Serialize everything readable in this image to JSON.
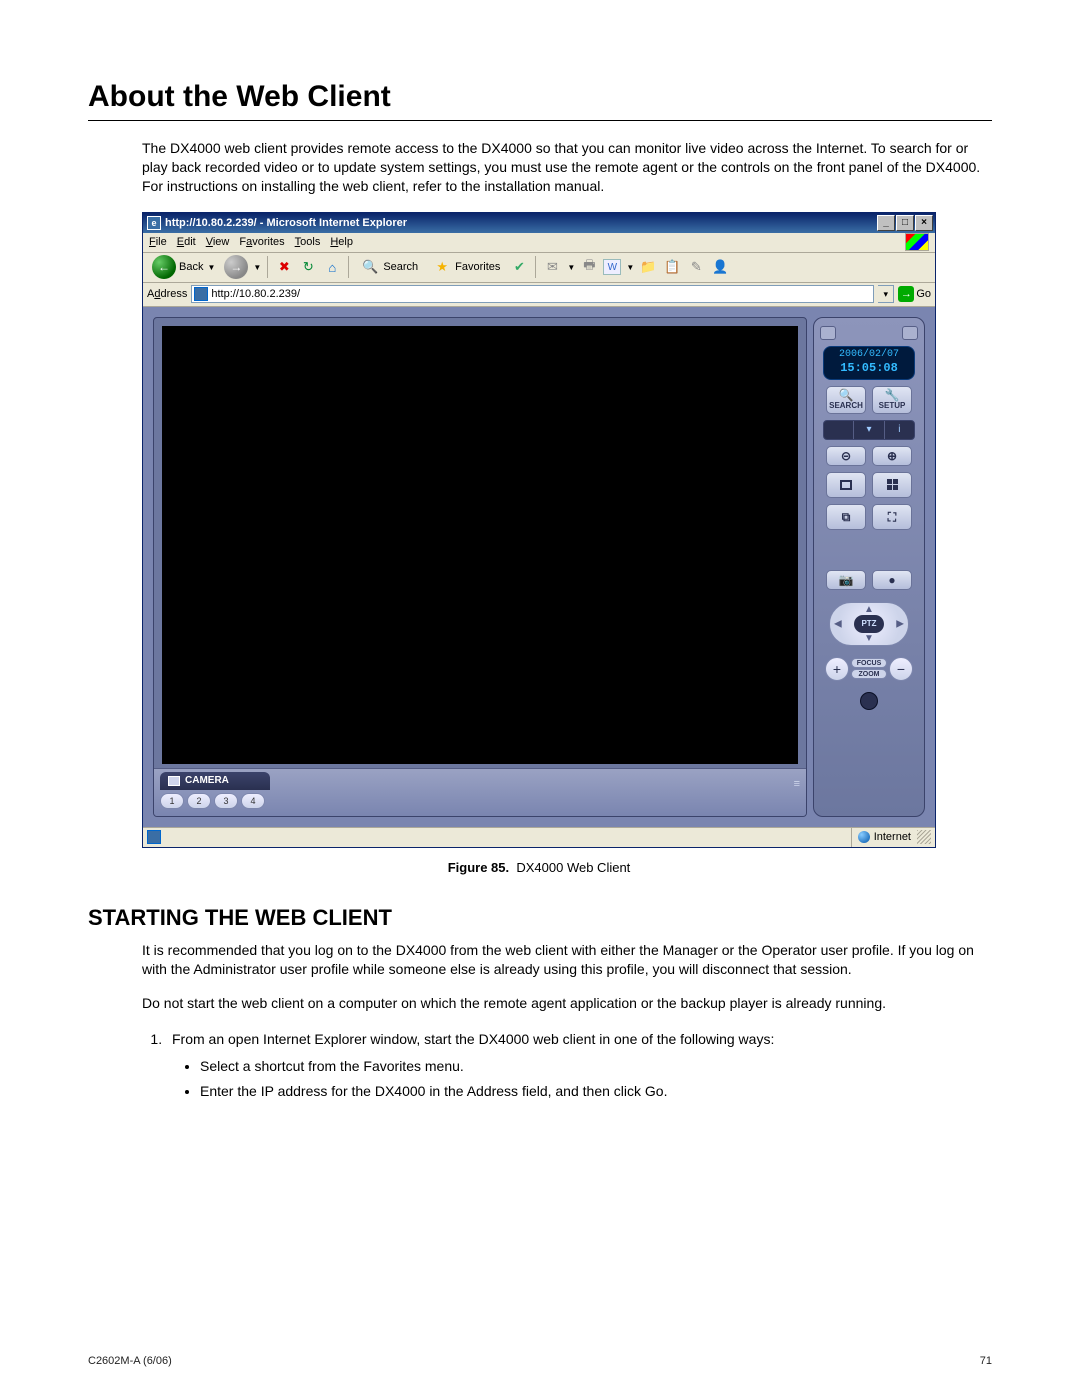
{
  "heading": "About the Web Client",
  "intro": "The DX4000 web client provides remote access to the DX4000 so that you can monitor live video across the Internet. To search for or play back recorded video or to update system settings, you must use the remote agent or the controls on the front panel of the DX4000. For instructions on installing the web client, refer to the installation manual.",
  "ie": {
    "title": "http://10.80.2.239/ - Microsoft Internet Explorer",
    "menu": {
      "file": "File",
      "edit": "Edit",
      "view": "View",
      "favorites": "Favorites",
      "tools": "Tools",
      "help": "Help"
    },
    "toolbar": {
      "back": "Back",
      "search": "Search",
      "favorites": "Favorites"
    },
    "address_label": "Address",
    "address_value": "http://10.80.2.239/",
    "go": "Go",
    "status_zone": "Internet"
  },
  "panel": {
    "date": "2006/02/07",
    "time": "15:05:08",
    "search": "SEARCH",
    "setup": "SETUP",
    "ptz": "PTZ",
    "focus": "FOCUS",
    "zoom": "ZOOM"
  },
  "camera": {
    "label": "CAMERA",
    "nums": [
      "1",
      "2",
      "3",
      "4"
    ]
  },
  "figure": {
    "label": "Figure 85.",
    "caption": "DX4000 Web Client"
  },
  "h2": "STARTING THE WEB CLIENT",
  "p2": "It is recommended that you log on to the DX4000 from the web client with either the Manager or the Operator user profile. If you log on with the Administrator user profile while someone else is already using this profile, you will disconnect that session.",
  "p3": "Do not start the web client on a computer on which the remote agent application or the backup player is already running.",
  "step1": "From an open Internet Explorer window, start the DX4000 web client in one of the following ways:",
  "b1": "Select a shortcut from the Favorites menu.",
  "b2": "Enter the IP address for the DX4000 in the Address field, and then click Go.",
  "footer_left": "C2602M-A (6/06)",
  "footer_right": "71"
}
